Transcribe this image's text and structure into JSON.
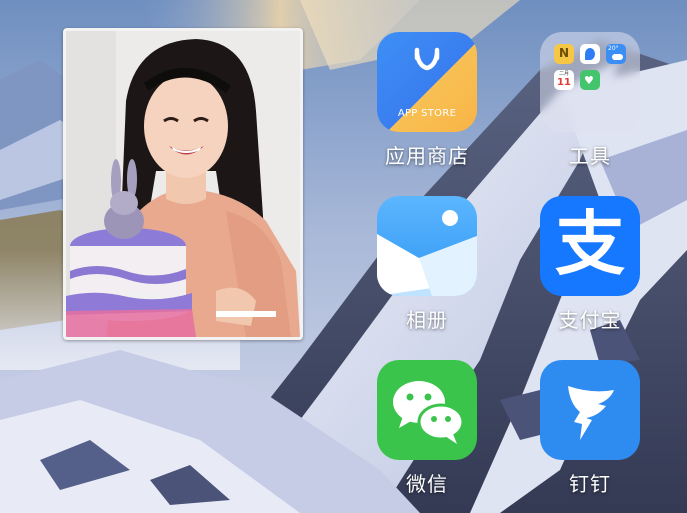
{
  "apps": [
    {
      "label": "应用商店",
      "icon_text": "APP STORE",
      "icon": "app-store-icon"
    },
    {
      "label": "工具",
      "icon": "tools-folder-icon"
    },
    {
      "label": "相册",
      "icon": "photos-icon"
    },
    {
      "label": "支付宝",
      "icon_glyph": "支",
      "icon": "alipay-icon"
    },
    {
      "label": "微信",
      "icon": "wechat-icon"
    },
    {
      "label": "钉钉",
      "icon": "dingtalk-icon"
    }
  ],
  "folder_minis": {
    "notes_letter": "N",
    "weather_temp": "20°",
    "calendar_header": "二月",
    "calendar_day": "11"
  },
  "colors": {
    "app_store_blue": "#3d8ff5",
    "app_store_yellow": "#f7c054",
    "photos_blue": "#3aa0f5",
    "alipay_blue": "#1677ff",
    "wechat_green": "#3bc44b",
    "dingtalk_blue": "#2e8cf0"
  }
}
